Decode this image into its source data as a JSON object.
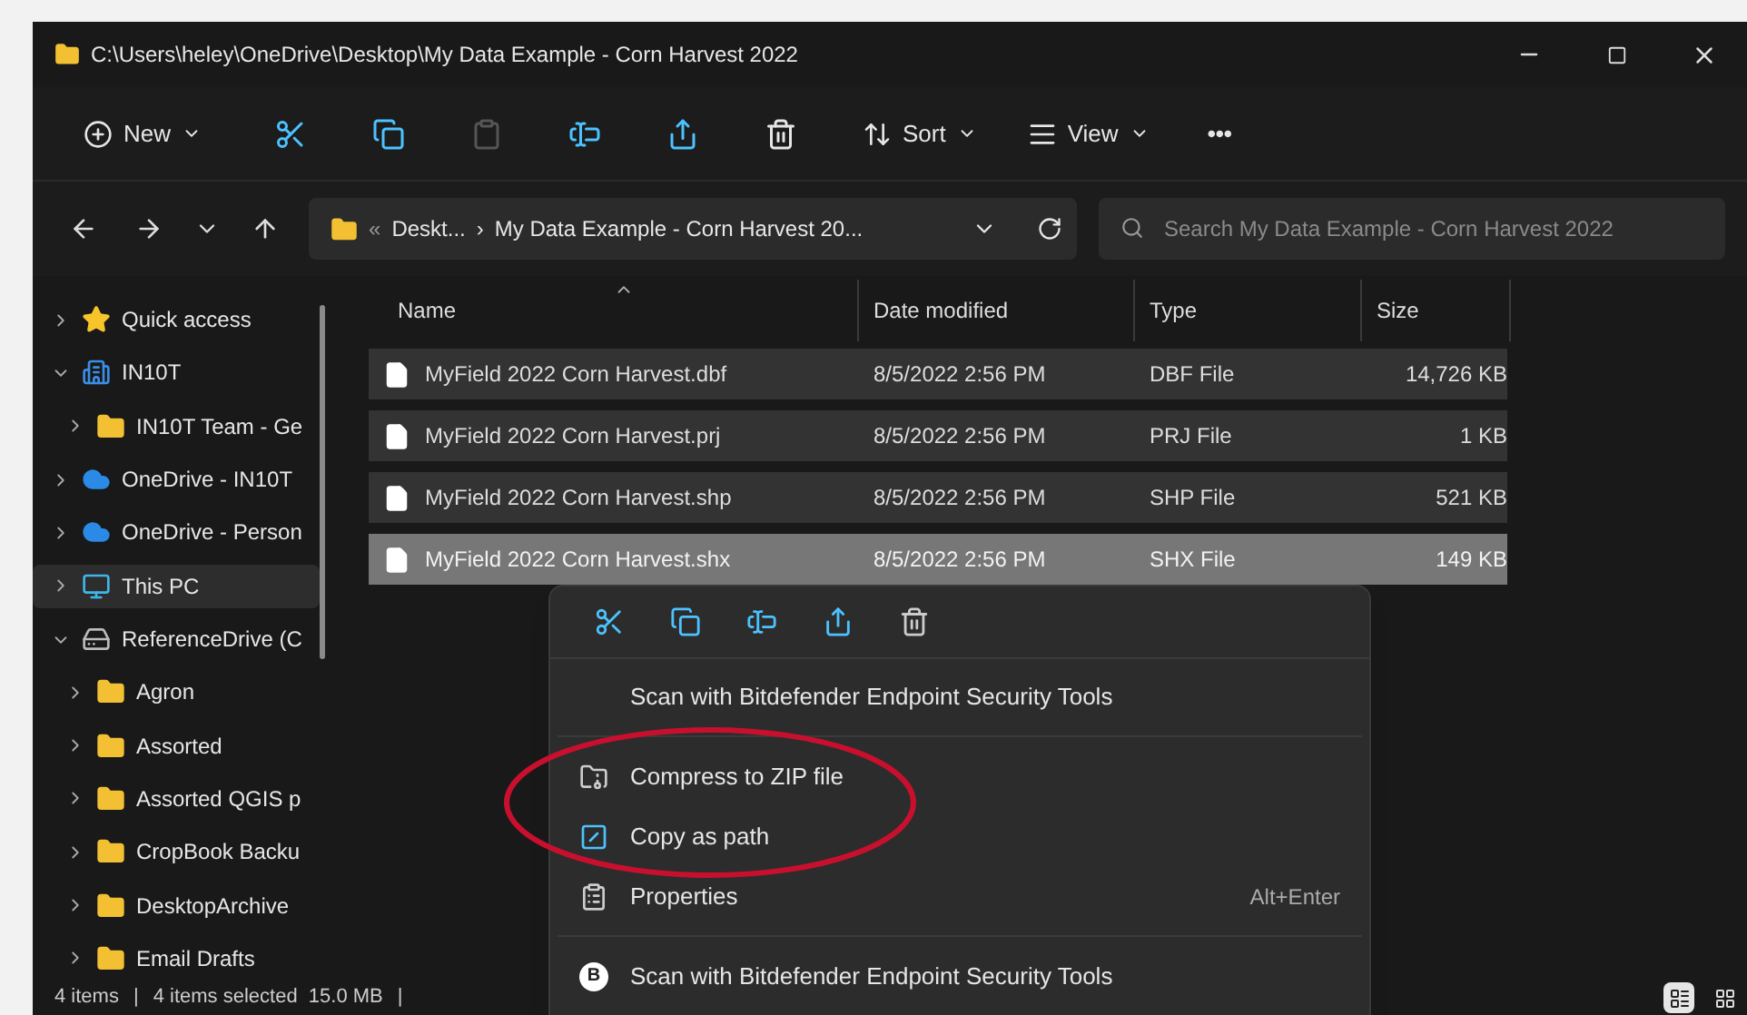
{
  "window": {
    "title": "C:\\Users\\heley\\OneDrive\\Desktop\\My Data Example - Corn Harvest 2022"
  },
  "toolbar": {
    "items": [
      {
        "kind": "new",
        "label": "New",
        "disabled": false
      },
      {
        "kind": "cut",
        "disabled": false
      },
      {
        "kind": "copy",
        "disabled": false
      },
      {
        "kind": "paste",
        "disabled": true
      },
      {
        "kind": "rename",
        "disabled": false
      },
      {
        "kind": "share",
        "disabled": false
      },
      {
        "kind": "delete",
        "disabled": false
      },
      {
        "kind": "sort",
        "label": "Sort",
        "disabled": false
      },
      {
        "kind": "view",
        "label": "View",
        "disabled": false
      },
      {
        "kind": "more",
        "label": "•••",
        "disabled": false
      }
    ]
  },
  "address_bar": {
    "overflow": "«",
    "crumbs": [
      "Deskt...",
      "My Data Example - Corn Harvest 20..."
    ],
    "separator": "›"
  },
  "search": {
    "placeholder": "Search My Data Example - Corn Harvest 2022"
  },
  "sidebar": {
    "items": [
      {
        "label": "Quick access",
        "kind": "star",
        "expanded": false,
        "selected": false
      },
      {
        "label": "IN10T",
        "kind": "org",
        "expanded": true,
        "selected": false,
        "children": [
          {
            "label": "IN10T Team - Ge",
            "kind": "folder",
            "expanded": false,
            "selected": false
          }
        ]
      },
      {
        "label": "OneDrive - IN10T",
        "kind": "cloud",
        "expanded": false,
        "selected": false
      },
      {
        "label": "OneDrive - Person",
        "kind": "cloud",
        "expanded": false,
        "selected": false
      },
      {
        "label": "This PC",
        "kind": "pc",
        "expanded": false,
        "selected": true
      },
      {
        "label": "ReferenceDrive (C",
        "kind": "drive",
        "expanded": true,
        "selected": false,
        "children": [
          {
            "label": "Agron",
            "kind": "folder",
            "expanded": false,
            "selected": false
          },
          {
            "label": "Assorted",
            "kind": "folder",
            "expanded": false,
            "selected": false
          },
          {
            "label": "Assorted QGIS p",
            "kind": "folder",
            "expanded": false,
            "selected": false
          },
          {
            "label": "CropBook Backu",
            "kind": "folder",
            "expanded": false,
            "selected": false
          },
          {
            "label": "DesktopArchive",
            "kind": "folder",
            "expanded": false,
            "selected": false
          },
          {
            "label": "Email Drafts",
            "kind": "folder",
            "expanded": false,
            "selected": false
          }
        ]
      }
    ]
  },
  "table": {
    "columns": [
      "Name",
      "Date modified",
      "Type",
      "Size"
    ],
    "rows": [
      {
        "name": "MyField 2022 Corn Harvest.dbf",
        "date": "8/5/2022 2:56 PM",
        "type": "DBF File",
        "size": "14,726 KB",
        "selected": true,
        "hovered": false
      },
      {
        "name": "MyField 2022 Corn Harvest.prj",
        "date": "8/5/2022 2:56 PM",
        "type": "PRJ File",
        "size": "1 KB",
        "selected": true,
        "hovered": false
      },
      {
        "name": "MyField 2022 Corn Harvest.shp",
        "date": "8/5/2022 2:56 PM",
        "type": "SHP File",
        "size": "521 KB",
        "selected": true,
        "hovered": false
      },
      {
        "name": "MyField 2022 Corn Harvest.shx",
        "date": "8/5/2022 2:56 PM",
        "type": "SHX File",
        "size": "149 KB",
        "selected": true,
        "hovered": true
      }
    ]
  },
  "context_menu": {
    "actions": [
      {
        "kind": "cut"
      },
      {
        "kind": "copy"
      },
      {
        "kind": "rename"
      },
      {
        "kind": "share"
      },
      {
        "kind": "delete"
      }
    ],
    "items": [
      {
        "kind": "scan",
        "label": "Scan with Bitdefender Endpoint Security Tools"
      },
      {
        "kind": "separator"
      },
      {
        "kind": "zip",
        "label": "Compress to ZIP file"
      },
      {
        "kind": "path",
        "label": "Copy as path"
      },
      {
        "kind": "properties",
        "label": "Properties",
        "shortcut": "Alt+Enter"
      },
      {
        "kind": "separator"
      },
      {
        "kind": "badge",
        "label": "Scan with Bitdefender Endpoint Security Tools",
        "icon_text": "B"
      }
    ]
  },
  "status_bar": {
    "count": "4 items",
    "separator": "|",
    "selection": "4 items selected  15.0 MB",
    "end_separator": "|"
  },
  "view_switch": [
    {
      "kind": "details",
      "selected": true
    },
    {
      "kind": "tiles",
      "selected": false
    }
  ]
}
